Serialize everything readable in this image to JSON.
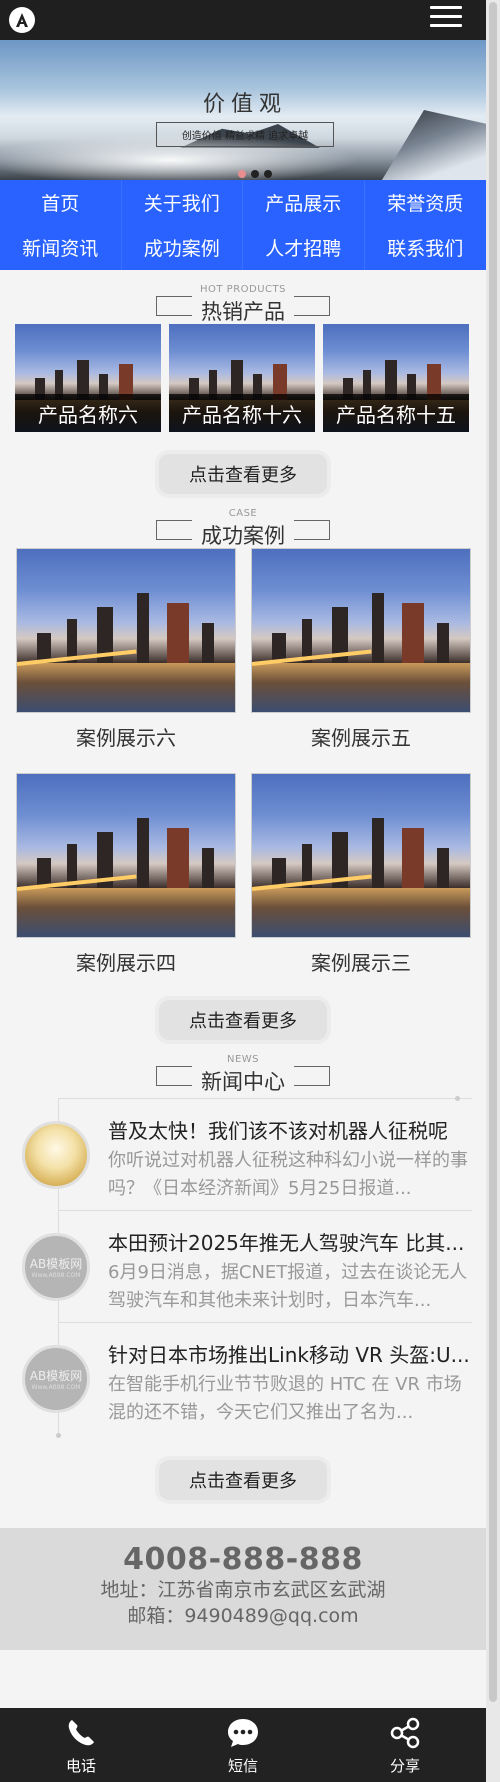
{
  "header": {
    "logo_icon": "logo-a-icon",
    "menu_icon": "hamburger-menu-icon"
  },
  "banner": {
    "headline": "价值观",
    "slogan": "创造价值    精益求精    追求卓越",
    "slides": 3,
    "active_slide": 1
  },
  "nav": {
    "items": [
      {
        "label": "首页"
      },
      {
        "label": "关于我们"
      },
      {
        "label": "产品展示"
      },
      {
        "label": "荣誉资质"
      },
      {
        "label": "新闻资讯"
      },
      {
        "label": "成功案例"
      },
      {
        "label": "人才招聘"
      },
      {
        "label": "联系我们"
      }
    ]
  },
  "products": {
    "title_en": "HOT PRODUCTS",
    "title": "热销产品",
    "items": [
      {
        "name": "产品名称六"
      },
      {
        "name": "产品名称十六"
      },
      {
        "name": "产品名称十五"
      }
    ],
    "more_label": "点击查看更多"
  },
  "cases": {
    "title_en": "CASE",
    "title": "成功案例",
    "items": [
      {
        "name": "案例展示六"
      },
      {
        "name": "案例展示五"
      },
      {
        "name": "案例展示四"
      },
      {
        "name": "案例展示三"
      }
    ],
    "more_label": "点击查看更多"
  },
  "news": {
    "title_en": "NEWS",
    "title": "新闻中心",
    "items": [
      {
        "title": "普及太快！我们该不该对机器人征税呢",
        "desc": "你听说过对机器人征税这种科幻小说一样的事吗？《日本经济新闻》5月25日报道...",
        "thumb": "wheat"
      },
      {
        "title": "本田预计2025年推无人驾驶汽车 比其...",
        "desc": "6月9日消息，据CNET报道，过去在谈论无人驾驶汽车和其他未来计划时，日本汽车...",
        "thumb": "ab"
      },
      {
        "title": "针对日本市场推出Link移动 VR 头盔:U...",
        "desc": "在智能手机行业节节败退的 HTC 在 VR 市场混的还不错，今天它们又推出了名为...",
        "thumb": "ab"
      }
    ],
    "thumb_text": "AB模板网",
    "thumb_subtext": "Www.AB98.COM",
    "more_label": "点击查看更多"
  },
  "contact": {
    "phone": "4008-888-888",
    "address": "地址：江苏省南京市玄武区玄武湖",
    "email": "邮箱：9490489@qq.com"
  },
  "footer": {
    "items": [
      {
        "label": "电话",
        "icon": "phone-icon"
      },
      {
        "label": "短信",
        "icon": "message-icon"
      },
      {
        "label": "分享",
        "icon": "share-icon"
      }
    ]
  },
  "colors": {
    "nav_bg": "#2962ff",
    "header_bg": "#1f1f1f",
    "footer_bg": "#222222"
  }
}
